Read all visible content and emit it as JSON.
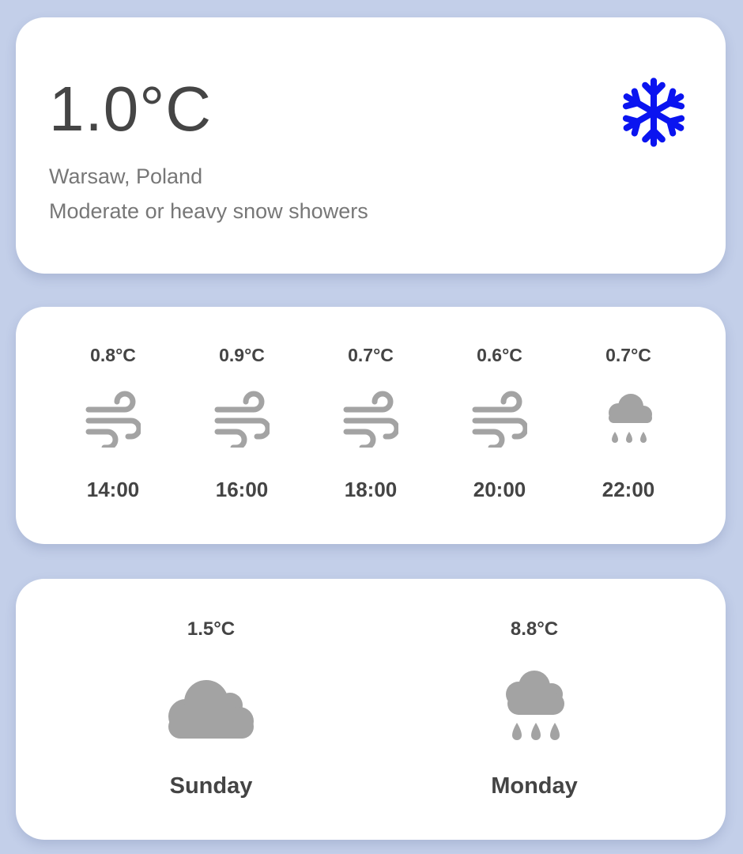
{
  "current": {
    "temperature": "1.0°C",
    "location": "Warsaw, Poland",
    "condition": "Moderate or heavy snow showers",
    "icon": "snowflake-icon",
    "icon_color": "#0a14f0"
  },
  "hourly": [
    {
      "temp": "0.8°C",
      "time": "14:00",
      "icon": "wind-icon"
    },
    {
      "temp": "0.9°C",
      "time": "16:00",
      "icon": "wind-icon"
    },
    {
      "temp": "0.7°C",
      "time": "18:00",
      "icon": "wind-icon"
    },
    {
      "temp": "0.6°C",
      "time": "20:00",
      "icon": "wind-icon"
    },
    {
      "temp": "0.7°C",
      "time": "22:00",
      "icon": "rain-cloud-icon"
    }
  ],
  "daily": [
    {
      "temp": "1.5°C",
      "day": "Sunday",
      "icon": "cloud-icon"
    },
    {
      "temp": "8.8°C",
      "day": "Monday",
      "icon": "rain-cloud-icon"
    }
  ],
  "colors": {
    "background": "#c3cfe9",
    "card": "#ffffff",
    "icon_gray": "#a3a3a3",
    "text_dark": "#444444"
  }
}
